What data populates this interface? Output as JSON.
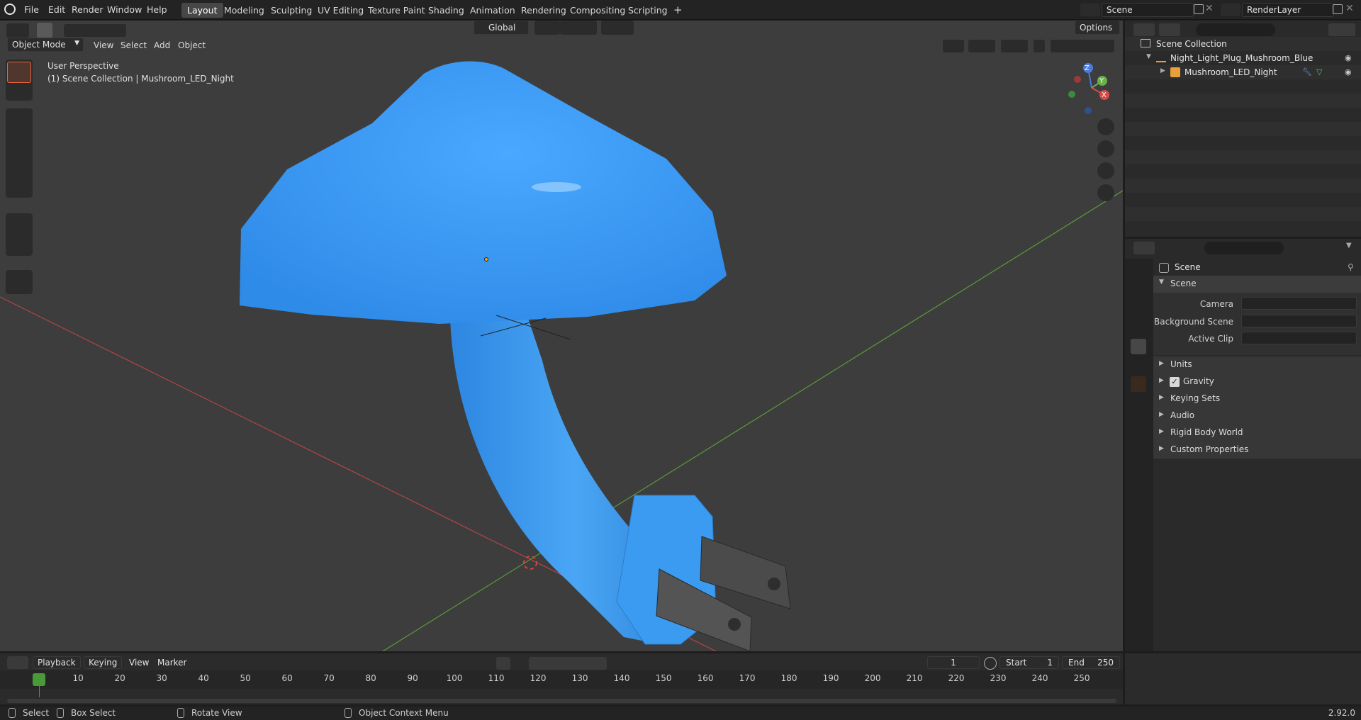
{
  "topbar": {
    "menus": [
      "File",
      "Edit",
      "Render",
      "Window",
      "Help"
    ],
    "workspaces": [
      "Layout",
      "Modeling",
      "Sculpting",
      "UV Editing",
      "Texture Paint",
      "Shading",
      "Animation",
      "Rendering",
      "Compositing",
      "Scripting"
    ],
    "active_workspace": "Layout",
    "add_tab": "+",
    "scene": "Scene",
    "render_layer": "RenderLayer"
  },
  "viewport_header": {
    "mode": "Object Mode",
    "menus": [
      "View",
      "Select",
      "Add",
      "Object"
    ],
    "orientation": "Global",
    "options": "Options"
  },
  "viewport": {
    "perspective": "User Perspective",
    "collection_info": "(1) Scene Collection | Mushroom_LED_Night",
    "gizmo": {
      "z": "Z",
      "y": "Y",
      "x": "X"
    }
  },
  "outliner": {
    "root": "Scene Collection",
    "collection": "Night_Light_Plug_Mushroom_Blue",
    "object": "Mushroom_LED_Night"
  },
  "properties": {
    "header": "Scene",
    "panel": "Scene",
    "fields": [
      {
        "label": "Camera"
      },
      {
        "label": "Background Scene"
      },
      {
        "label": "Active Clip"
      }
    ],
    "subpanels": [
      "Units",
      "Gravity",
      "Keying Sets",
      "Audio",
      "Rigid Body World",
      "Custom Properties"
    ],
    "gravity_checked": true
  },
  "timeline": {
    "menus": [
      "Playback",
      "Keying",
      "View",
      "Marker"
    ],
    "current_frame": "1",
    "start_label": "Start",
    "start": "1",
    "end_label": "End",
    "end": "250",
    "ticks": [
      "1",
      "10",
      "20",
      "30",
      "40",
      "50",
      "60",
      "70",
      "80",
      "90",
      "100",
      "110",
      "120",
      "130",
      "140",
      "150",
      "160",
      "170",
      "180",
      "190",
      "200",
      "210",
      "220",
      "230",
      "240",
      "250"
    ]
  },
  "statusbar": {
    "select": "Select",
    "box_select": "Box Select",
    "rotate": "Rotate View",
    "context": "Object Context Menu",
    "version": "2.92.0"
  },
  "colors": {
    "accent": "#e9653b",
    "mushroom": "#3a9bf5",
    "active_tab": "#474747"
  }
}
